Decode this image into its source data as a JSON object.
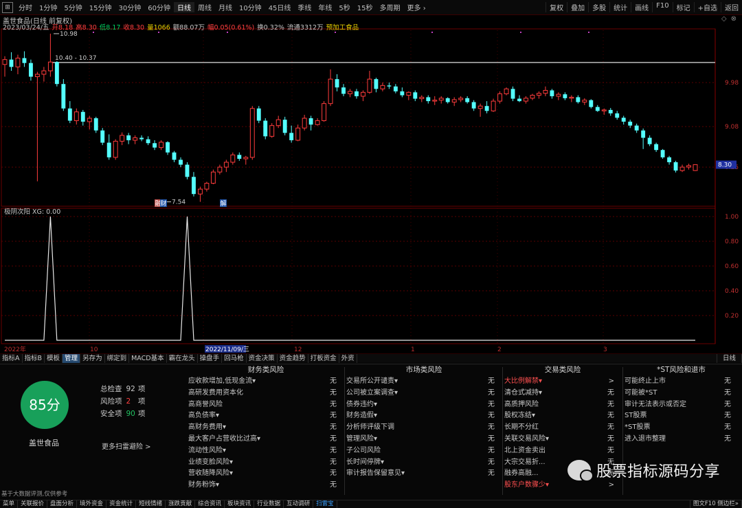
{
  "toolbar": {
    "menu_icon": "⊞",
    "periods": [
      "分时",
      "1分钟",
      "5分钟",
      "15分钟",
      "30分钟",
      "60分钟",
      "日线",
      "周线",
      "月线",
      "10分钟",
      "45日线",
      "季线",
      "年线",
      "5秒",
      "15秒",
      "多周期",
      "更多 ›"
    ],
    "active_period": "日线",
    "tools": [
      "复权",
      "叠加",
      "多股",
      "统计",
      "画线",
      "F10",
      "标记",
      "+自选",
      "返回"
    ]
  },
  "chart_header": {
    "title": "盖世食品(日线 前复权)",
    "quote": [
      {
        "text": "2023/03/24/五",
        "color": "white"
      },
      {
        "text": "开8.18",
        "color": "red"
      },
      {
        "text": "高8.30",
        "color": "red"
      },
      {
        "text": "低8.17",
        "color": "green"
      },
      {
        "text": "收8.30",
        "color": "red"
      },
      {
        "text": "量1066",
        "color": "yellow"
      },
      {
        "text": "额88.07万",
        "color": "white"
      },
      {
        "text": "幅0.05(0.61%)",
        "color": "red"
      },
      {
        "text": "换0.32%",
        "color": "white"
      },
      {
        "text": "流通3312万",
        "color": "white"
      },
      {
        "text": "预加工食品",
        "color": "yellow"
      }
    ],
    "window_controls": [
      "◇",
      "⊗"
    ]
  },
  "chart_data": [
    {
      "type": "candlestick",
      "title": "盖世食品(日线 前复权)",
      "y_ticks": [
        "9.98",
        "9.08",
        "8.25"
      ],
      "price_tag": "8.30",
      "annotations": [
        "10.98",
        "10.40 - 10.37",
        "7.54"
      ],
      "markers": [
        "融",
        "财",
        "解"
      ],
      "candles": [
        {
          "o": 10.35,
          "h": 10.52,
          "l": 10.1,
          "c": 10.45
        },
        {
          "o": 10.45,
          "h": 10.6,
          "l": 10.22,
          "c": 10.3
        },
        {
          "o": 10.3,
          "h": 10.55,
          "l": 10.15,
          "c": 10.48
        },
        {
          "o": 10.48,
          "h": 10.62,
          "l": 10.3,
          "c": 10.38
        },
        {
          "o": 10.38,
          "h": 10.45,
          "l": 10.02,
          "c": 10.1
        },
        {
          "o": 10.1,
          "h": 10.2,
          "l": 7.96,
          "c": 10.15
        },
        {
          "o": 10.15,
          "h": 10.3,
          "l": 10.0,
          "c": 10.22
        },
        {
          "o": 10.22,
          "h": 10.98,
          "l": 10.1,
          "c": 10.4
        },
        {
          "o": 10.4,
          "h": 10.42,
          "l": 9.9,
          "c": 9.95
        },
        {
          "o": 9.95,
          "h": 10.05,
          "l": 9.4,
          "c": 9.45
        },
        {
          "o": 9.45,
          "h": 9.6,
          "l": 9.15,
          "c": 9.2
        },
        {
          "o": 9.2,
          "h": 9.45,
          "l": 9.12,
          "c": 9.38
        },
        {
          "o": 9.38,
          "h": 9.42,
          "l": 9.1,
          "c": 9.18
        },
        {
          "o": 9.18,
          "h": 9.3,
          "l": 9.02,
          "c": 9.25
        },
        {
          "o": 9.25,
          "h": 9.28,
          "l": 8.95,
          "c": 9.0
        },
        {
          "o": 9.0,
          "h": 9.05,
          "l": 8.7,
          "c": 8.75
        },
        {
          "o": 8.75,
          "h": 8.92,
          "l": 8.4,
          "c": 8.45
        },
        {
          "o": 8.45,
          "h": 8.82,
          "l": 8.4,
          "c": 8.78
        },
        {
          "o": 8.78,
          "h": 8.96,
          "l": 8.7,
          "c": 8.9
        },
        {
          "o": 8.9,
          "h": 8.95,
          "l": 8.72,
          "c": 8.8
        },
        {
          "o": 8.8,
          "h": 8.9,
          "l": 8.72,
          "c": 8.85
        },
        {
          "o": 8.85,
          "h": 8.9,
          "l": 8.78,
          "c": 8.82
        },
        {
          "o": 8.82,
          "h": 8.88,
          "l": 8.7,
          "c": 8.74
        },
        {
          "o": 8.74,
          "h": 8.8,
          "l": 8.6,
          "c": 8.65
        },
        {
          "o": 8.65,
          "h": 8.8,
          "l": 8.6,
          "c": 8.76
        },
        {
          "o": 8.76,
          "h": 8.78,
          "l": 8.5,
          "c": 8.55
        },
        {
          "o": 8.55,
          "h": 8.58,
          "l": 8.35,
          "c": 8.4
        },
        {
          "o": 8.4,
          "h": 8.45,
          "l": 8.25,
          "c": 8.3
        },
        {
          "o": 8.3,
          "h": 8.35,
          "l": 8.0,
          "c": 8.05
        },
        {
          "o": 8.05,
          "h": 8.15,
          "l": 7.65,
          "c": 7.7
        },
        {
          "o": 7.7,
          "h": 7.85,
          "l": 7.54,
          "c": 7.8
        },
        {
          "o": 7.8,
          "h": 7.95,
          "l": 7.75,
          "c": 7.92
        },
        {
          "o": 7.92,
          "h": 8.2,
          "l": 7.9,
          "c": 8.15
        },
        {
          "o": 8.15,
          "h": 8.3,
          "l": 8.1,
          "c": 8.25
        },
        {
          "o": 8.25,
          "h": 8.4,
          "l": 8.15,
          "c": 8.35
        },
        {
          "o": 8.35,
          "h": 8.55,
          "l": 8.3,
          "c": 8.5
        },
        {
          "o": 8.5,
          "h": 8.55,
          "l": 8.38,
          "c": 8.42
        },
        {
          "o": 8.42,
          "h": 8.48,
          "l": 8.3,
          "c": 8.45
        },
        {
          "o": 8.45,
          "h": 9.5,
          "l": 8.4,
          "c": 9.45
        },
        {
          "o": 9.45,
          "h": 9.5,
          "l": 9.15,
          "c": 9.2
        },
        {
          "o": 9.2,
          "h": 9.25,
          "l": 8.82,
          "c": 8.88
        },
        {
          "o": 8.88,
          "h": 9.15,
          "l": 8.85,
          "c": 9.1
        },
        {
          "o": 9.1,
          "h": 9.3,
          "l": 9.05,
          "c": 9.22
        },
        {
          "o": 9.22,
          "h": 9.28,
          "l": 8.9,
          "c": 8.95
        },
        {
          "o": 8.95,
          "h": 9.1,
          "l": 8.75,
          "c": 8.8
        },
        {
          "o": 8.8,
          "h": 9.12,
          "l": 8.78,
          "c": 9.05
        },
        {
          "o": 9.05,
          "h": 9.32,
          "l": 9.0,
          "c": 9.25
        },
        {
          "o": 9.25,
          "h": 9.3,
          "l": 9.0,
          "c": 9.12
        },
        {
          "o": 9.12,
          "h": 9.25,
          "l": 9.1,
          "c": 9.2
        },
        {
          "o": 9.2,
          "h": 9.6,
          "l": 9.18,
          "c": 9.55
        },
        {
          "o": 9.55,
          "h": 10.25,
          "l": 9.5,
          "c": 10.05
        },
        {
          "o": 10.05,
          "h": 10.15,
          "l": 9.8,
          "c": 9.88
        },
        {
          "o": 9.88,
          "h": 9.95,
          "l": 9.7,
          "c": 9.75
        },
        {
          "o": 9.75,
          "h": 9.85,
          "l": 9.68,
          "c": 9.8
        },
        {
          "o": 9.8,
          "h": 9.85,
          "l": 9.65,
          "c": 9.7
        },
        {
          "o": 9.7,
          "h": 9.82,
          "l": 9.6,
          "c": 9.78
        },
        {
          "o": 9.78,
          "h": 10.22,
          "l": 9.75,
          "c": 10.05
        },
        {
          "o": 10.05,
          "h": 10.08,
          "l": 9.78,
          "c": 9.85
        },
        {
          "o": 9.85,
          "h": 9.98,
          "l": 9.8,
          "c": 9.92
        },
        {
          "o": 9.92,
          "h": 9.98,
          "l": 9.85,
          "c": 9.9
        },
        {
          "o": 9.9,
          "h": 9.95,
          "l": 9.76,
          "c": 9.8
        },
        {
          "o": 9.8,
          "h": 9.88,
          "l": 9.68,
          "c": 9.72
        },
        {
          "o": 9.72,
          "h": 9.8,
          "l": 9.62,
          "c": 9.78
        },
        {
          "o": 9.78,
          "h": 9.82,
          "l": 9.6,
          "c": 9.65
        },
        {
          "o": 9.65,
          "h": 9.72,
          "l": 9.58,
          "c": 9.68
        },
        {
          "o": 9.68,
          "h": 9.72,
          "l": 9.55,
          "c": 9.6
        },
        {
          "o": 9.6,
          "h": 9.7,
          "l": 9.52,
          "c": 9.62
        },
        {
          "o": 9.62,
          "h": 9.7,
          "l": 9.55,
          "c": 9.66
        },
        {
          "o": 9.66,
          "h": 9.68,
          "l": 9.55,
          "c": 9.58
        },
        {
          "o": 9.58,
          "h": 9.68,
          "l": 9.5,
          "c": 9.63
        },
        {
          "o": 9.63,
          "h": 9.7,
          "l": 9.58,
          "c": 9.66
        },
        {
          "o": 9.66,
          "h": 9.7,
          "l": 9.55,
          "c": 9.58
        },
        {
          "o": 9.58,
          "h": 9.62,
          "l": 9.4,
          "c": 9.45
        },
        {
          "o": 9.45,
          "h": 9.55,
          "l": 9.28,
          "c": 9.5
        },
        {
          "o": 9.5,
          "h": 9.6,
          "l": 9.35,
          "c": 9.4
        },
        {
          "o": 9.4,
          "h": 9.65,
          "l": 9.38,
          "c": 9.6
        },
        {
          "o": 9.6,
          "h": 9.8,
          "l": 9.55,
          "c": 9.75
        },
        {
          "o": 9.75,
          "h": 9.88,
          "l": 9.72,
          "c": 9.85
        },
        {
          "o": 9.85,
          "h": 9.9,
          "l": 9.6,
          "c": 9.65
        },
        {
          "o": 9.65,
          "h": 9.72,
          "l": 9.58,
          "c": 9.6
        },
        {
          "o": 9.6,
          "h": 9.7,
          "l": 9.55,
          "c": 9.66
        },
        {
          "o": 9.66,
          "h": 9.75,
          "l": 9.62,
          "c": 9.72
        },
        {
          "o": 9.72,
          "h": 9.8,
          "l": 9.65,
          "c": 9.76
        },
        {
          "o": 9.76,
          "h": 9.9,
          "l": 9.7,
          "c": 9.82
        },
        {
          "o": 9.82,
          "h": 9.85,
          "l": 9.65,
          "c": 9.7
        },
        {
          "o": 9.7,
          "h": 9.78,
          "l": 9.62,
          "c": 9.74
        },
        {
          "o": 9.74,
          "h": 9.78,
          "l": 9.62,
          "c": 9.66
        },
        {
          "o": 9.66,
          "h": 9.72,
          "l": 9.58,
          "c": 9.68
        },
        {
          "o": 9.68,
          "h": 9.72,
          "l": 9.55,
          "c": 9.58
        },
        {
          "o": 9.58,
          "h": 9.66,
          "l": 9.52,
          "c": 9.62
        },
        {
          "o": 9.62,
          "h": 9.64,
          "l": 9.45,
          "c": 9.48
        },
        {
          "o": 9.48,
          "h": 9.52,
          "l": 9.38,
          "c": 9.4
        },
        {
          "o": 9.4,
          "h": 9.45,
          "l": 9.32,
          "c": 9.42
        },
        {
          "o": 9.42,
          "h": 9.46,
          "l": 9.3,
          "c": 9.35
        },
        {
          "o": 9.35,
          "h": 9.4,
          "l": 9.22,
          "c": 9.26
        },
        {
          "o": 9.26,
          "h": 9.3,
          "l": 9.12,
          "c": 9.18
        },
        {
          "o": 9.18,
          "h": 9.22,
          "l": 9.05,
          "c": 9.1
        },
        {
          "o": 9.1,
          "h": 9.14,
          "l": 8.95,
          "c": 9.0
        },
        {
          "o": 9.0,
          "h": 9.04,
          "l": 8.62,
          "c": 8.85
        },
        {
          "o": 8.85,
          "h": 8.9,
          "l": 8.68,
          "c": 8.72
        },
        {
          "o": 8.72,
          "h": 8.75,
          "l": 8.56,
          "c": 8.6
        },
        {
          "o": 8.6,
          "h": 8.62,
          "l": 8.42,
          "c": 8.45
        },
        {
          "o": 8.45,
          "h": 8.48,
          "l": 8.3,
          "c": 8.35
        },
        {
          "o": 8.35,
          "h": 8.38,
          "l": 8.14,
          "c": 8.18
        },
        {
          "o": 8.18,
          "h": 8.3,
          "l": 8.15,
          "c": 8.25
        },
        {
          "o": 8.25,
          "h": 8.32,
          "l": 8.2,
          "c": 8.28
        },
        {
          "o": 8.18,
          "h": 8.3,
          "l": 8.17,
          "c": 8.3
        }
      ]
    },
    {
      "type": "line",
      "title": "极阴次阳 XG: 0.00",
      "y_ticks": [
        "1.00",
        "0.80",
        "0.60",
        "0.40",
        "0.20"
      ],
      "ylim": [
        0,
        1
      ],
      "x_labels": [
        "2022年",
        "10",
        "2022/11/09/三",
        "12",
        "1",
        "2",
        "3"
      ],
      "signal_bars": [
        7,
        28
      ],
      "values_desc": "XG signal is 0 except 1.00 at two bars"
    }
  ],
  "tabs": {
    "items": [
      "指标A",
      "指标B",
      "模板",
      "管理",
      "另存为",
      "绑定到",
      "MACD基本",
      "霸在龙头",
      "操盘手",
      "回马枪",
      "资金决策",
      "资金趋势",
      "打板资金",
      "外资"
    ],
    "active": "管理",
    "right": "日线"
  },
  "risk_panel": {
    "score": "85分",
    "company": "盖世食品",
    "stats": [
      {
        "label": "总检查",
        "value": "92",
        "unit": "项",
        "color": "#c8c8c8"
      },
      {
        "label": "风险项",
        "value": "2",
        "unit": "项",
        "color": "#ff4040"
      },
      {
        "label": "安全项",
        "value": "90",
        "unit": "项",
        "color": "#20c060"
      }
    ],
    "more_link": "更多扫雷避险 >",
    "disclaimer": "基于大数据评测,仅供参考",
    "columns": [
      {
        "title": "财务类风险",
        "rows": [
          {
            "label": "应收款增加,低现金流▾",
            "status": "无"
          },
          {
            "label": "高研发费用资本化",
            "status": "无"
          },
          {
            "label": "高商誉风险",
            "status": "无"
          },
          {
            "label": "高负债率▾",
            "status": "无"
          },
          {
            "label": "高财务费用▾",
            "status": "无"
          },
          {
            "label": "最大客户占营收比过高▾",
            "status": "无"
          },
          {
            "label": "流动性风险▾",
            "status": "无"
          },
          {
            "label": "业绩变脸风险▾",
            "status": "无"
          },
          {
            "label": "营收随降风险▾",
            "status": "无"
          },
          {
            "label": "财务粉饰▾",
            "status": "无"
          }
        ]
      },
      {
        "title": "市场类风险",
        "rows": [
          {
            "label": "交易所公开谴责▾",
            "status": "无"
          },
          {
            "label": "公司被立案调查▾",
            "status": "无"
          },
          {
            "label": "债券违约▾",
            "status": "无"
          },
          {
            "label": "财务造假▾",
            "status": "无"
          },
          {
            "label": "分析师评级下调",
            "status": "无"
          },
          {
            "label": "管理风险▾",
            "status": "无"
          },
          {
            "label": "子公司风险",
            "status": "无"
          },
          {
            "label": "长时间停牌▾",
            "status": "无"
          },
          {
            "label": "审计报告保留意见▾",
            "status": "无"
          }
        ]
      },
      {
        "title": "交易类风险",
        "rows": [
          {
            "label": "大比例解禁▾",
            "status": ">",
            "hl": true
          },
          {
            "label": "清仓式减持▾",
            "status": "无"
          },
          {
            "label": "高质押风险",
            "status": "无"
          },
          {
            "label": "股权冻结▾",
            "status": "无"
          },
          {
            "label": "长期不分红",
            "status": "无"
          },
          {
            "label": "关联交易风险▾",
            "status": "无"
          },
          {
            "label": "北上资金卖出",
            "status": "无"
          },
          {
            "label": "大宗交易折...",
            "status": "无"
          },
          {
            "label": "融券高融...",
            "status": "无"
          },
          {
            "label": "股东户数骤少▾",
            "status": ">",
            "hl": true
          }
        ]
      },
      {
        "title": "*ST风险和退市",
        "rows": [
          {
            "label": "可能终止上市",
            "status": "无"
          },
          {
            "label": "可能被*ST",
            "status": "无"
          },
          {
            "label": "审计无法表示或否定",
            "status": "无"
          },
          {
            "label": "ST股票",
            "status": "无"
          },
          {
            "label": "*ST股票",
            "status": "无"
          },
          {
            "label": "进入退市整理",
            "status": "无"
          }
        ]
      }
    ]
  },
  "watermark": "股票指标源码分享",
  "statusbar": {
    "items": [
      "菜单",
      "关联报价",
      "盘面分析",
      "境外资金",
      "资金统计",
      "短线情绪",
      "涨跌贡献",
      "综合资讯",
      "板块资讯",
      "行业数据",
      "互动调研",
      "扫雷宝"
    ],
    "active": "扫雷宝",
    "right": "图文F10 侧边栏»"
  },
  "colors": {
    "up": "#ff3c3c",
    "down": "#54ffff",
    "grid": "#6a0000",
    "signal": "#e8e8e8",
    "safe_green": "#18a05a"
  }
}
